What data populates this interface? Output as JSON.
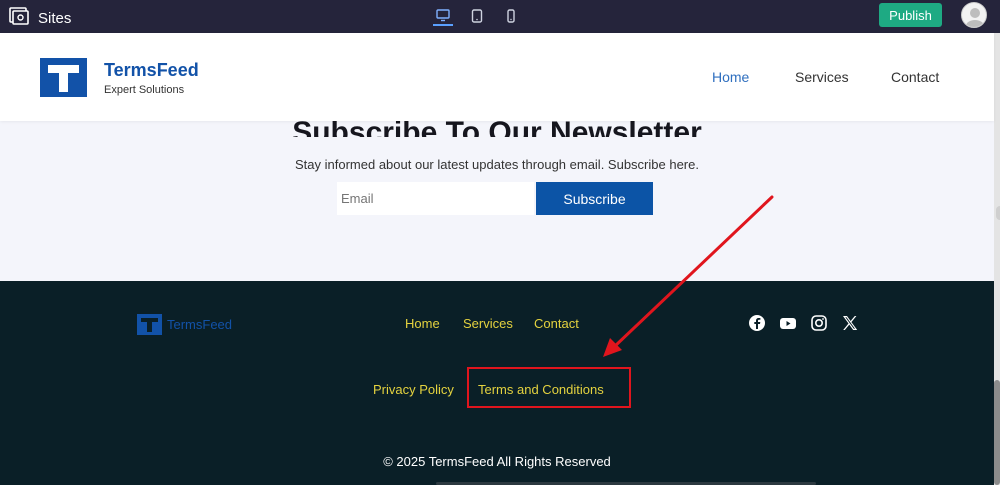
{
  "editor": {
    "sites_label": "Sites",
    "publish_label": "Publish",
    "devices": [
      "desktop-icon",
      "tablet-icon",
      "mobile-icon"
    ]
  },
  "header": {
    "brand_name": "TermsFeed",
    "brand_tagline": "Expert Solutions",
    "nav": [
      "Home",
      "Services",
      "Contact"
    ]
  },
  "newsletter": {
    "title": "Subscribe To Our Newsletter",
    "subtitle": "Stay informed about our latest updates through email. Subscribe here.",
    "email_placeholder": "Email",
    "button_label": "Subscribe"
  },
  "footer": {
    "brand_name": "TermsFeed",
    "nav": [
      "Home",
      "Services",
      "Contact"
    ],
    "social": [
      "facebook-icon",
      "youtube-icon",
      "instagram-icon",
      "x-icon"
    ],
    "legal": [
      "Privacy Policy",
      "Terms and Conditions"
    ],
    "copyright": "© 2025 TermsFeed All Rights Reserved"
  },
  "colors": {
    "editor_bar": "#25243b",
    "publish": "#1eaa83",
    "brand_blue": "#1252a8",
    "footer_bg": "#0a1f27",
    "footer_link": "#e4d23f",
    "annotation_red": "#e0151d"
  }
}
